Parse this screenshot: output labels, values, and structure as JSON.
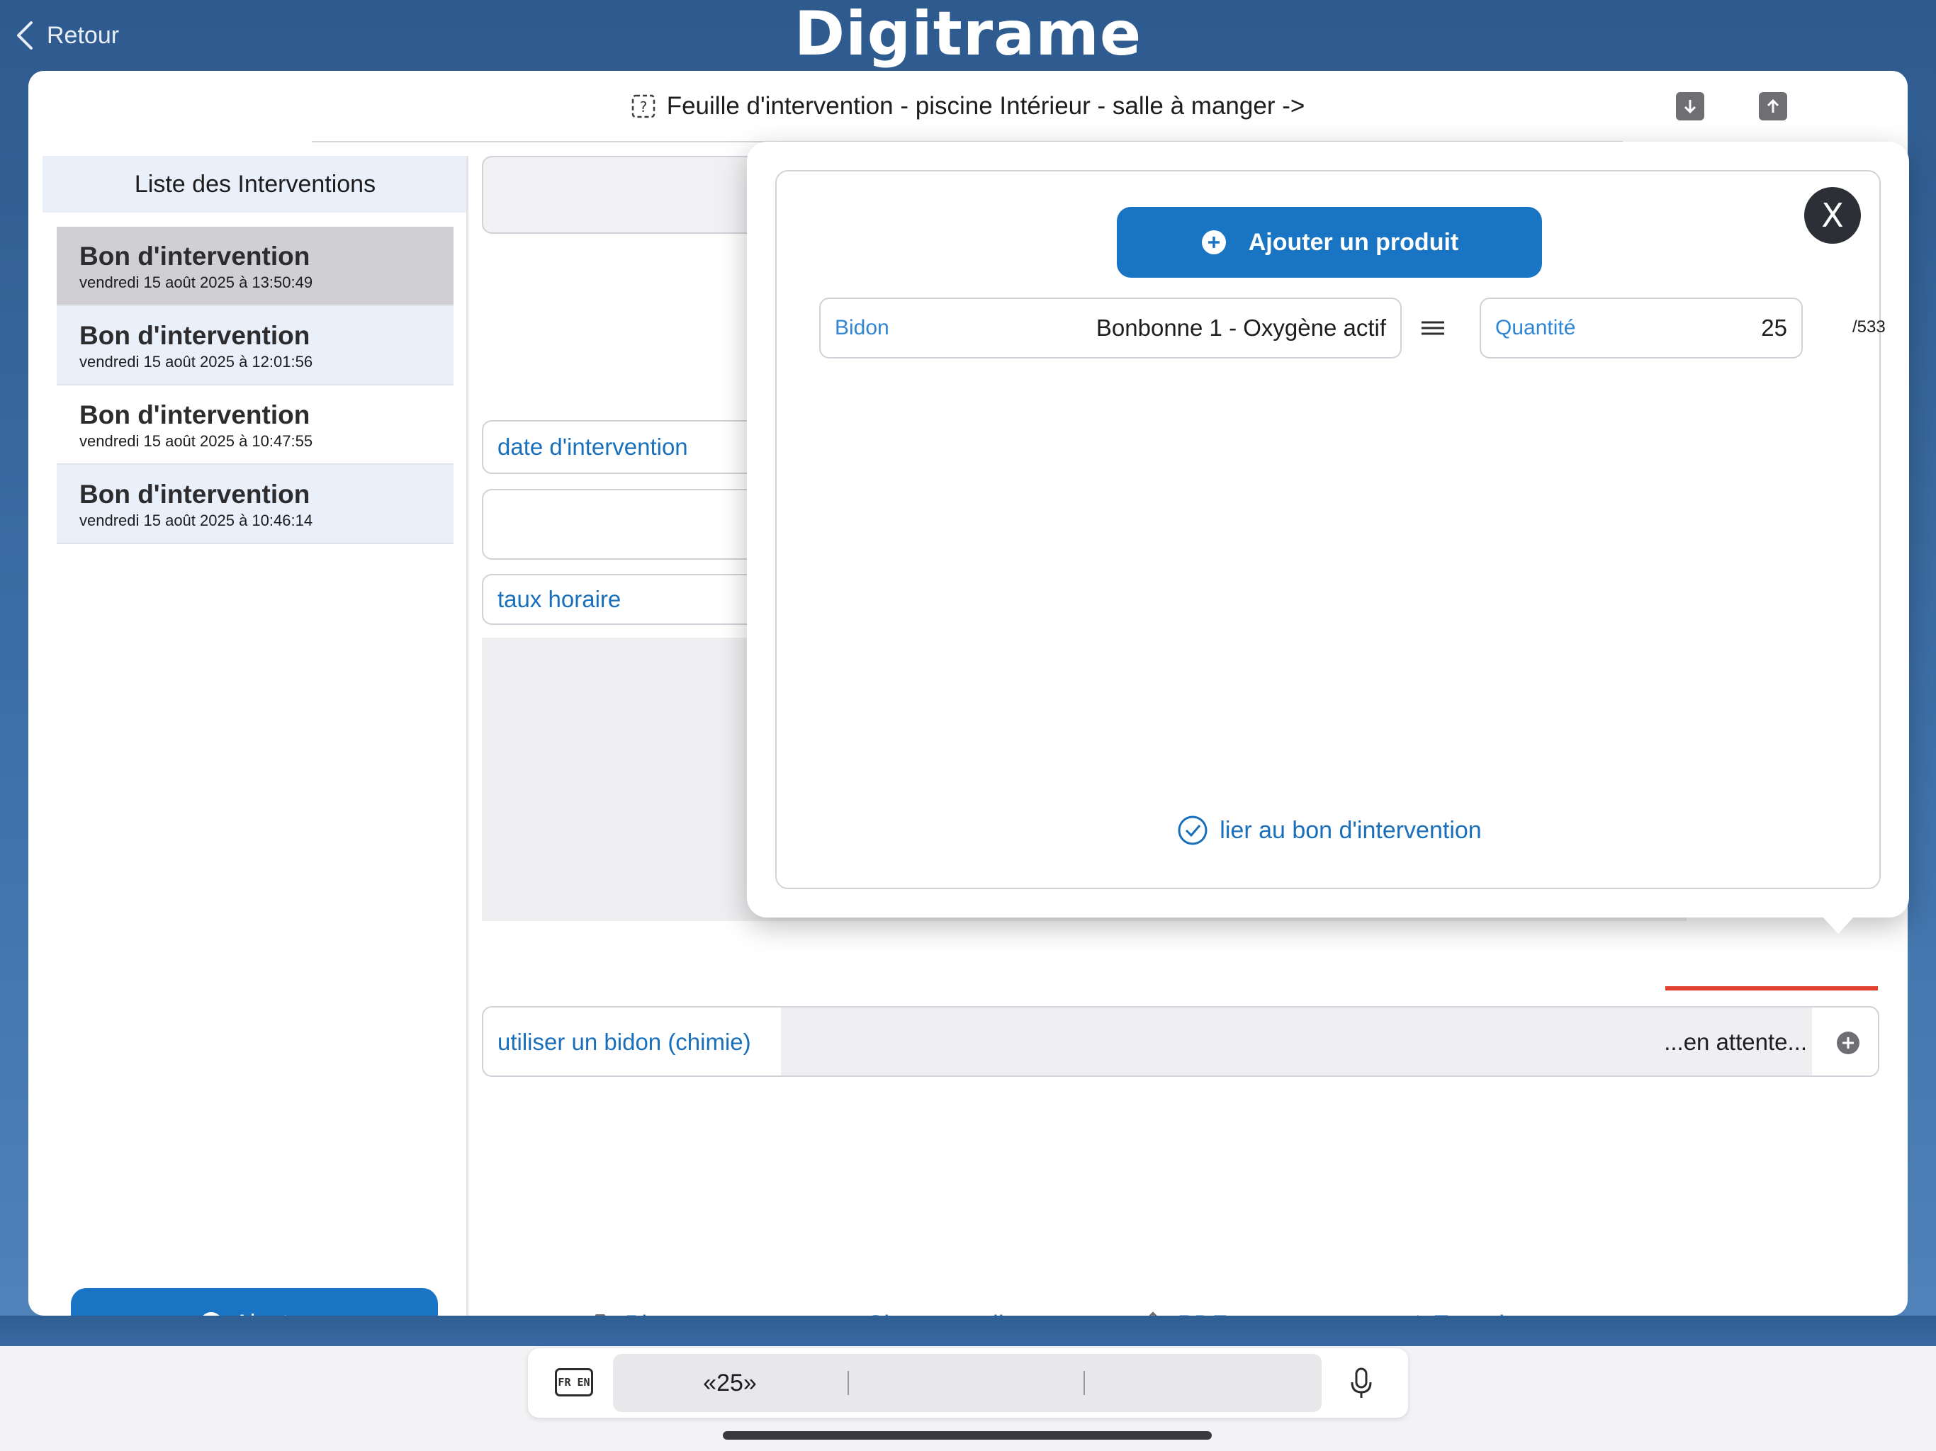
{
  "header": {
    "back_label": "Retour",
    "logo_text": "Digitrame"
  },
  "title_bar": {
    "title": "Feuille d'intervention - piscine Intérieur - salle à manger ->"
  },
  "sidebar": {
    "header": "Liste des Interventions",
    "items": [
      {
        "title": "Bon d'intervention",
        "date": "vendredi 15 août 2025 à 13:50:49"
      },
      {
        "title": "Bon d'intervention",
        "date": "vendredi 15 août 2025 à 12:01:56"
      },
      {
        "title": "Bon d'intervention",
        "date": "vendredi 15 août 2025 à 10:47:55"
      },
      {
        "title": "Bon d'intervention",
        "date": "vendredi 15 août 2025 à 10:46:14"
      }
    ],
    "add_label": "Ajouter"
  },
  "form": {
    "date_label": "date d'intervention",
    "rate_label": "taux horaire",
    "chem_label": "utiliser un bidon (chimie)",
    "chem_status": "...en attente..."
  },
  "actions": {
    "photos": "Photos",
    "signature": "Signature client",
    "pdf": "PDF",
    "save": "Enregistrer"
  },
  "modal": {
    "close_label": "X",
    "add_product_label": "Ajouter un produit",
    "bidon_label": "Bidon",
    "bidon_value": "Bonbonne 1 - Oxygène actif",
    "quantity_label": "Quantité",
    "quantity_value": "25",
    "quantity_max": "/533",
    "link_label": "lier au bon d'intervention"
  },
  "keyboard": {
    "lang_label": "FR EN",
    "suggestions": [
      "«25»",
      "",
      ""
    ]
  },
  "colors": {
    "accent": "#1a74c4",
    "link": "#1a6fba",
    "selected_row": "#d0d0d4",
    "tinted_row": "#e9f0fa",
    "alert": "#e0402e"
  }
}
